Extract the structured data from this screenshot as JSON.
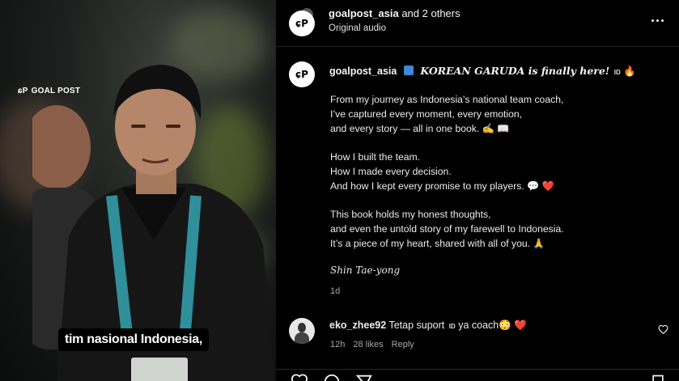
{
  "media": {
    "brand_text": "GOAL POST",
    "brand_mark": "ɕP",
    "caption_text": "tim nasional Indonesia,"
  },
  "header": {
    "username": "goalpost_asia",
    "others_text": "and 2 others",
    "audio_label": "Original audio",
    "avatar_text": "ɕP"
  },
  "post": {
    "username": "goalpost_asia",
    "title": "KOREAN GARUDA is finally here!",
    "id_badge": "ID",
    "fire": "🔥",
    "paragraphs": [
      [
        "From my journey as Indonesia’s national team coach,",
        "I’ve captured every moment, every emotion,",
        "and every story — all in one book. ✍️ 📖"
      ],
      [
        "How I built the team.",
        "How I made every decision.",
        "And how I kept every promise to my players. 💬 ❤️"
      ],
      [
        "This book holds my honest thoughts,",
        "and even the untold story of my farewell to Indonesia.",
        "It’s a piece of my heart, shared with all of you. 🙏"
      ]
    ],
    "signature": "Shin Tae-yong",
    "time_ago": "1d"
  },
  "comment": {
    "username": "eko_zhee92",
    "text_before": "Tetap suport",
    "id_badge": "ID",
    "text_after": "ya coach😳",
    "heart": "❤️",
    "time": "12h",
    "likes": "28 likes",
    "reply_label": "Reply"
  },
  "colors": {
    "background": "#000000",
    "text": "#f5f5f5",
    "muted": "#a8a8a8",
    "heart": "#ff3e6c"
  }
}
